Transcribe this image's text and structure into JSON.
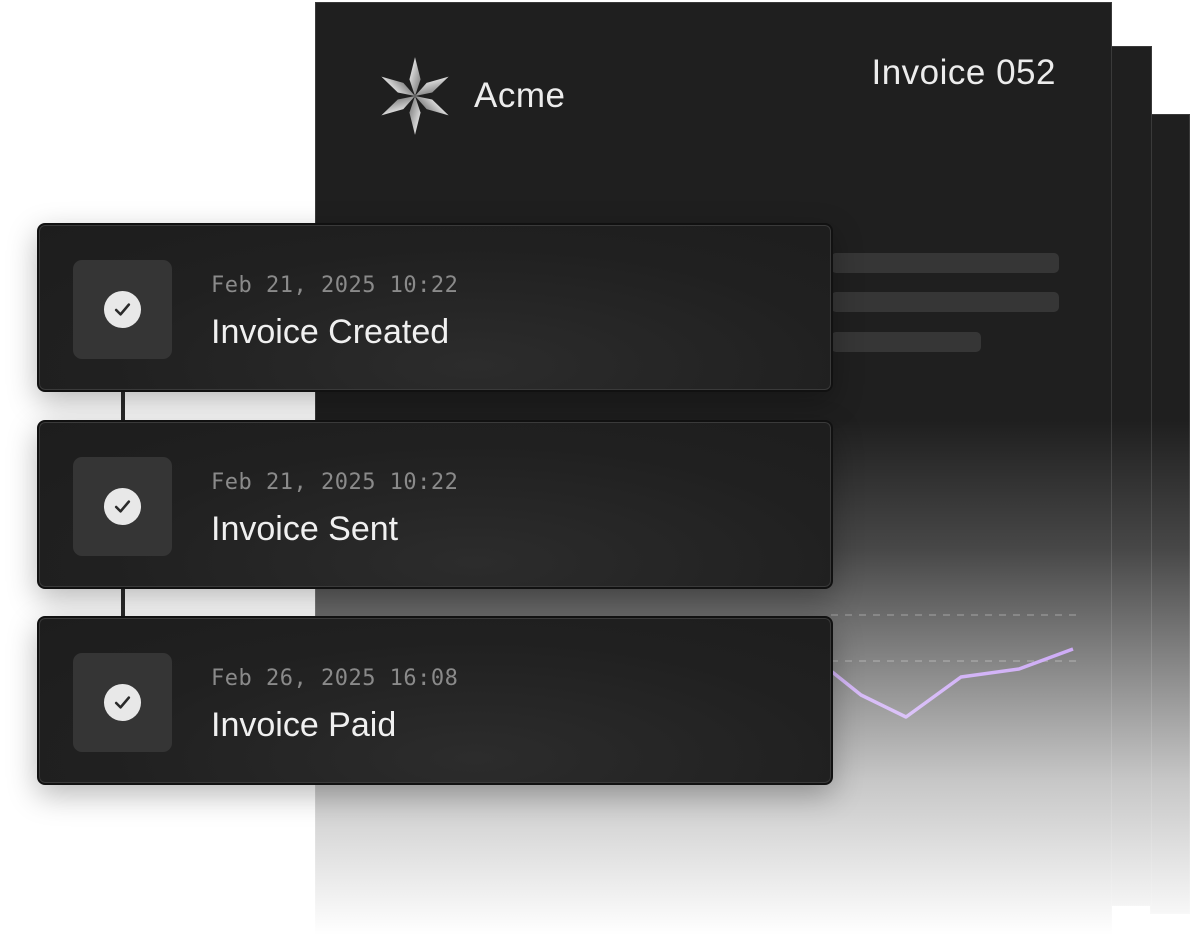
{
  "invoice": {
    "brand_name": "Acme",
    "title": "Invoice 052",
    "brand_logo_icon": "star-burst-logo-icon",
    "accent_color": "#a96df0",
    "chart_line_color": "#a96df0"
  },
  "timeline": {
    "events": [
      {
        "time": "Feb 21, 2025 10:22",
        "label": "Invoice Created",
        "status_icon": "check-circle-icon"
      },
      {
        "time": "Feb 21, 2025 10:22",
        "label": "Invoice Sent",
        "status_icon": "check-circle-icon"
      },
      {
        "time": "Feb 26, 2025 16:08",
        "label": "Invoice Paid",
        "status_icon": "check-circle-icon"
      }
    ]
  }
}
